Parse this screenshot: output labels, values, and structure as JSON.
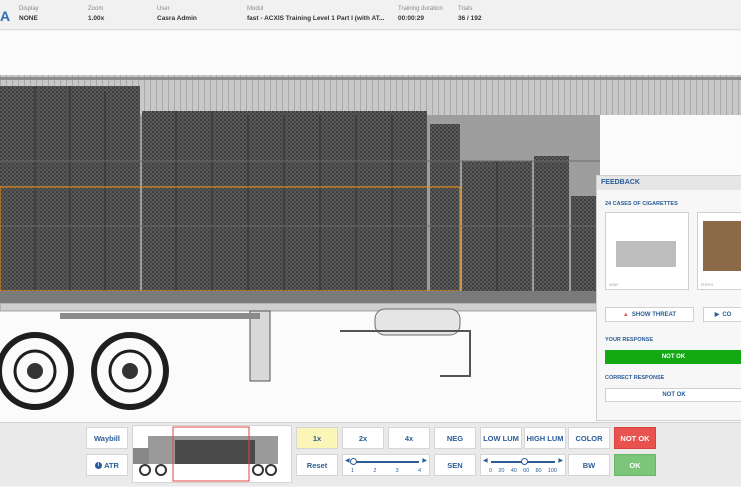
{
  "header": {
    "logo_text": "A",
    "fields": [
      {
        "label": "Display",
        "value": "NONE"
      },
      {
        "label": "Zoom",
        "value": "1.00x"
      },
      {
        "label": "User",
        "value": "Casra Admin"
      },
      {
        "label": "Modul",
        "value": "fast - ACXIS Training Level 1 Part I (with AT..."
      },
      {
        "label": "Training duration",
        "value": "00:00:29"
      },
      {
        "label": "Trials",
        "value": "36 / 192"
      }
    ]
  },
  "feedback": {
    "title": "FEEDBACK",
    "threat_name": "24 CASES OF CIGARETTES",
    "thumb1_caption": "XRAY",
    "thumb2_caption": "PHOTO",
    "show_threat_label": "SHOW THREAT",
    "second_button_label": "CO",
    "your_response_label": "YOUR RESPONSE",
    "your_response_value": "NOT OK",
    "correct_response_label": "CORRECT RESPONSE",
    "correct_response_value": "NOT OK"
  },
  "toolbar": {
    "waybill": "Waybill",
    "atr": "ATR",
    "zoom_1x": "1x",
    "zoom_2x": "2x",
    "zoom_4x": "4x",
    "reset": "Reset",
    "zoom_ticks": [
      "1",
      "2",
      "3",
      "4"
    ],
    "zoom_value": 1,
    "neg": "NEG",
    "sen": "SEN",
    "low_lum": "LOW LUM",
    "high_lum": "HIGH LUM",
    "lum_ticks": [
      "0",
      "20",
      "40",
      "60",
      "80",
      "100"
    ],
    "lum_value": 50,
    "color": "COLOR",
    "bw": "BW",
    "not_ok": "NOT OK",
    "ok": "OK"
  },
  "colors": {
    "accent": "#2a5c97",
    "selected": "#fbf5b8",
    "not_ok": "#e9534f",
    "ok": "#7cc67a",
    "response_green": "#13a913",
    "threat_box": "#e08a1a"
  }
}
